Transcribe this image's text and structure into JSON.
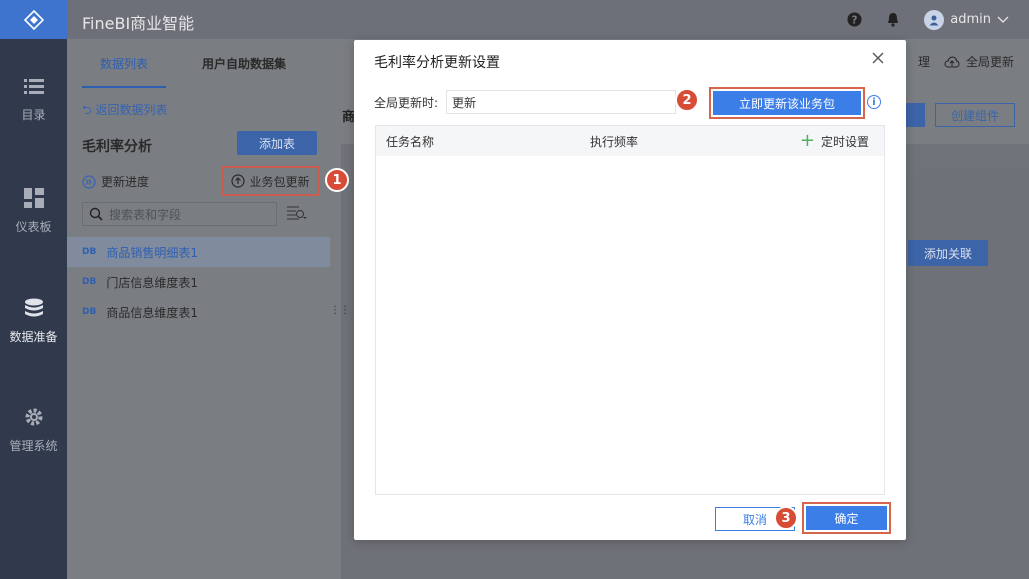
{
  "app": {
    "title": "FineBI商业智能",
    "user": "admin"
  },
  "nav": [
    {
      "icon": "list-icon",
      "label": "目录"
    },
    {
      "icon": "dashboard-icon",
      "label": "仪表板"
    },
    {
      "icon": "database-icon",
      "label": "数据准备"
    },
    {
      "icon": "gear-icon",
      "label": "管理系统"
    }
  ],
  "tabs": [
    "数据列表",
    "用户自助数据集"
  ],
  "panel": {
    "back": "返回数据列表",
    "pack_title": "毛利率分析",
    "add_table": "添加表",
    "progress": "更新进度",
    "pack_update": "业务包更新",
    "search_placeholder": "搜索表和字段",
    "tables": [
      "商品销售明细表1",
      "门店信息维度表1",
      "商品信息维度表1"
    ],
    "db_tag": "DB"
  },
  "background": {
    "right_partial": "理",
    "global_update": "全局更新",
    "create_component": "创建组件",
    "add_relation": "添加关联",
    "main_title_partial": "商"
  },
  "modal": {
    "title": "毛利率分析更新设置",
    "global_label": "全局更新时:",
    "global_value": "更新",
    "update_now": "立即更新该业务包",
    "col_task": "任务名称",
    "col_freq": "执行频率",
    "col_timer": "定时设置",
    "cancel": "取消",
    "ok": "确定"
  },
  "badges": [
    "1",
    "2",
    "3"
  ]
}
